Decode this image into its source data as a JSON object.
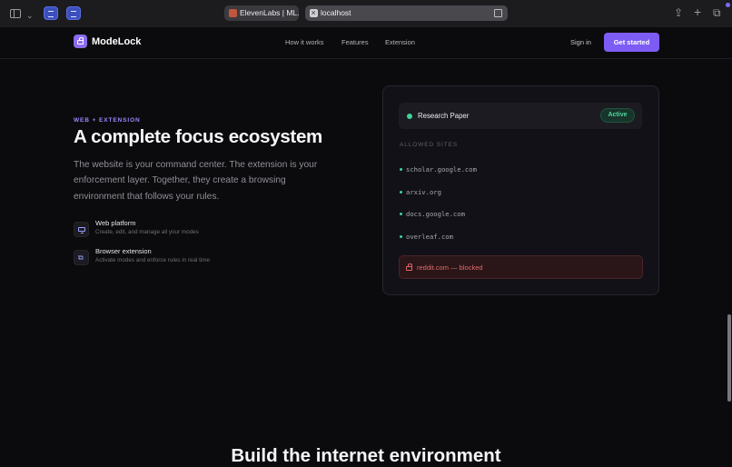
{
  "browser": {
    "tabs": [
      {
        "title": "ElevenLabs | ML...",
        "favicon_color": "#c2553e"
      }
    ],
    "address": "localhost"
  },
  "nav": {
    "brand": "ModeLock",
    "links": [
      "How it works",
      "Features",
      "Extension"
    ],
    "signin": "Sign in",
    "cta": "Get started"
  },
  "hero": {
    "eyebrow": "WEB + EXTENSION",
    "title": "A complete focus ecosystem",
    "lead": "The website is your command center. The extension is your enforcement layer. Together, they create a browsing environment that follows your rules.",
    "features": [
      {
        "title": "Web platform",
        "subtitle": "Create, edit, and manage all your modes",
        "icon": "monitor-icon"
      },
      {
        "title": "Browser extension",
        "subtitle": "Activate modes and enforce rules in real time",
        "icon": "puzzle-icon"
      }
    ]
  },
  "card": {
    "mode_name": "Research Paper",
    "status": "Active",
    "allowed_heading": "ALLOWED SITES",
    "allowed_sites": [
      "scholar.google.com",
      "arxiv.org",
      "docs.google.com",
      "overleaf.com"
    ],
    "blocked_text": "reddit.com — blocked"
  },
  "next_section": {
    "title": "Build the internet environment"
  },
  "colors": {
    "accent": "#7c5cf5",
    "active_green": "#3fd39a",
    "blocked_red": "#e06a6a"
  }
}
